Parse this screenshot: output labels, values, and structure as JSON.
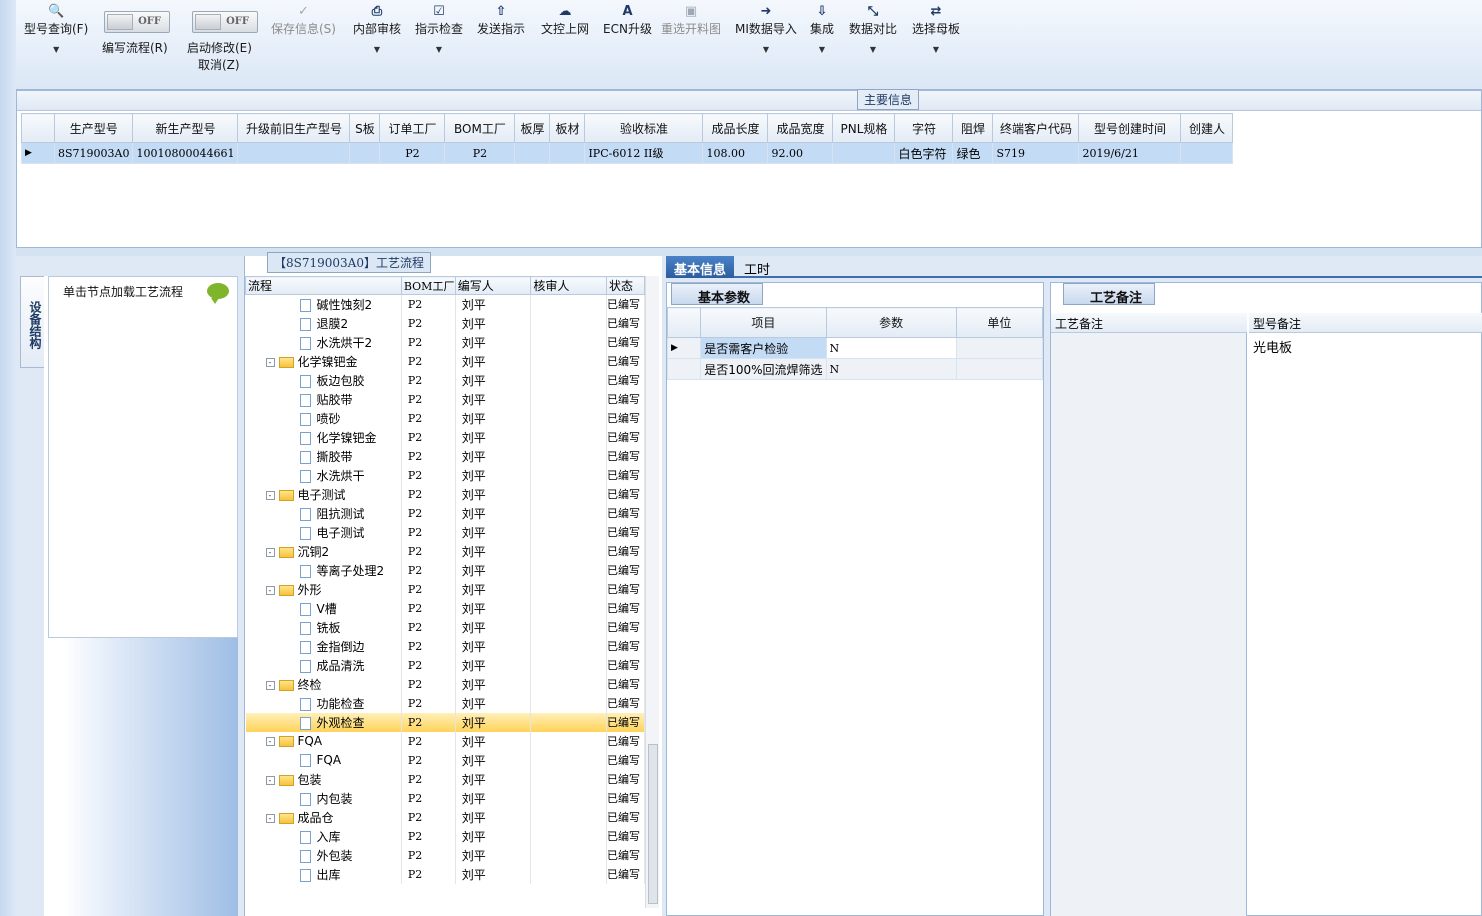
{
  "toolbar": {
    "query": "型号查询(F)",
    "edit_flow": "编写流程(R)",
    "edit_toggle": "OFF",
    "auto_modify": "启动修改(E)",
    "auto_toggle": "OFF",
    "cancel": "取消(Z)",
    "save": "保存信息(S)",
    "internal_review": "内部审核",
    "instruction_check": "指示检查",
    "send_instruction": "发送指示",
    "doc_online": "文控上网",
    "ecn_upgrade": "ECN升级",
    "reselect_cut": "重选开料图",
    "mi_import": "MI数据导入",
    "integrate": "集成",
    "compare": "数据对比",
    "select_master": "选择母板"
  },
  "main_info": {
    "section_label": "主要信息",
    "columns": [
      "生产型号",
      "新生产型号",
      "升级前旧生产型号",
      "S板",
      "订单工厂",
      "BOM工厂",
      "板厚",
      "板材",
      "验收标准",
      "成品长度",
      "成品宽度",
      "PNL规格",
      "字符",
      "阻焊",
      "终端客户代码",
      "型号创建时间",
      "创建人"
    ],
    "rows": [
      [
        "8S719003A0",
        "10010800044661",
        "",
        "",
        "P2",
        "P2",
        "",
        "",
        "IPC-6012 II级",
        "108.00",
        "92.00",
        "",
        "白色字符",
        "绿色",
        "S719",
        "2019/6/21",
        ""
      ]
    ]
  },
  "side": {
    "tab": "设备结构",
    "tree_title": "单击节点加载工艺流程"
  },
  "process": {
    "caption": "【8S719003A0】工艺流程",
    "columns": [
      "流程",
      "BOM工厂",
      "编写人",
      "核审人",
      "状态"
    ],
    "rows": [
      {
        "name": "碱性蚀刻2",
        "type": "doc",
        "factory": "P2",
        "writer": "刘平",
        "reviewer": "",
        "status": "已编写"
      },
      {
        "name": "退膜2",
        "type": "doc",
        "factory": "P2",
        "writer": "刘平",
        "reviewer": "",
        "status": "已编写"
      },
      {
        "name": "水洗烘干2",
        "type": "doc",
        "factory": "P2",
        "writer": "刘平",
        "reviewer": "",
        "status": "已编写"
      },
      {
        "name": "化学镍钯金",
        "type": "folder",
        "factory": "P2",
        "writer": "刘平",
        "reviewer": "",
        "status": "已编写"
      },
      {
        "name": "板边包胶",
        "type": "doc",
        "factory": "P2",
        "writer": "刘平",
        "reviewer": "",
        "status": "已编写"
      },
      {
        "name": "贴胶带",
        "type": "doc",
        "factory": "P2",
        "writer": "刘平",
        "reviewer": "",
        "status": "已编写"
      },
      {
        "name": "喷砂",
        "type": "doc",
        "factory": "P2",
        "writer": "刘平",
        "reviewer": "",
        "status": "已编写"
      },
      {
        "name": "化学镍钯金",
        "type": "doc",
        "factory": "P2",
        "writer": "刘平",
        "reviewer": "",
        "status": "已编写"
      },
      {
        "name": "撕胶带",
        "type": "doc",
        "factory": "P2",
        "writer": "刘平",
        "reviewer": "",
        "status": "已编写"
      },
      {
        "name": "水洗烘干",
        "type": "doc",
        "factory": "P2",
        "writer": "刘平",
        "reviewer": "",
        "status": "已编写"
      },
      {
        "name": "电子测试",
        "type": "folder",
        "factory": "P2",
        "writer": "刘平",
        "reviewer": "",
        "status": "已编写"
      },
      {
        "name": "阻抗测试",
        "type": "doc",
        "factory": "P2",
        "writer": "刘平",
        "reviewer": "",
        "status": "已编写"
      },
      {
        "name": "电子测试",
        "type": "doc",
        "factory": "P2",
        "writer": "刘平",
        "reviewer": "",
        "status": "已编写"
      },
      {
        "name": "沉铜2",
        "type": "folder",
        "factory": "P2",
        "writer": "刘平",
        "reviewer": "",
        "status": "已编写"
      },
      {
        "name": "等离子处理2",
        "type": "doc",
        "factory": "P2",
        "writer": "刘平",
        "reviewer": "",
        "status": "已编写"
      },
      {
        "name": "外形",
        "type": "folder",
        "factory": "P2",
        "writer": "刘平",
        "reviewer": "",
        "status": "已编写"
      },
      {
        "name": "V槽",
        "type": "doc",
        "factory": "P2",
        "writer": "刘平",
        "reviewer": "",
        "status": "已编写"
      },
      {
        "name": "铣板",
        "type": "doc",
        "factory": "P2",
        "writer": "刘平",
        "reviewer": "",
        "status": "已编写"
      },
      {
        "name": "金指倒边",
        "type": "doc",
        "factory": "P2",
        "writer": "刘平",
        "reviewer": "",
        "status": "已编写"
      },
      {
        "name": "成品清洗",
        "type": "doc",
        "factory": "P2",
        "writer": "刘平",
        "reviewer": "",
        "status": "已编写"
      },
      {
        "name": "终检",
        "type": "folder",
        "factory": "P2",
        "writer": "刘平",
        "reviewer": "",
        "status": "已编写"
      },
      {
        "name": "功能检查",
        "type": "doc",
        "factory": "P2",
        "writer": "刘平",
        "reviewer": "",
        "status": "已编写"
      },
      {
        "name": "外观检查",
        "type": "doc",
        "factory": "P2",
        "writer": "刘平",
        "reviewer": "",
        "status": "已编写",
        "selected": true
      },
      {
        "name": "FQA",
        "type": "folder",
        "factory": "P2",
        "writer": "刘平",
        "reviewer": "",
        "status": "已编写"
      },
      {
        "name": "FQA",
        "type": "doc",
        "factory": "P2",
        "writer": "刘平",
        "reviewer": "",
        "status": "已编写"
      },
      {
        "name": "包装",
        "type": "folder",
        "factory": "P2",
        "writer": "刘平",
        "reviewer": "",
        "status": "已编写"
      },
      {
        "name": "内包装",
        "type": "doc",
        "factory": "P2",
        "writer": "刘平",
        "reviewer": "",
        "status": "已编写"
      },
      {
        "name": "成品仓",
        "type": "folder",
        "factory": "P2",
        "writer": "刘平",
        "reviewer": "",
        "status": "已编写"
      },
      {
        "name": "入库",
        "type": "doc",
        "factory": "P2",
        "writer": "刘平",
        "reviewer": "",
        "status": "已编写"
      },
      {
        "name": "外包装",
        "type": "doc",
        "factory": "P2",
        "writer": "刘平",
        "reviewer": "",
        "status": "已编写"
      },
      {
        "name": "出库",
        "type": "doc",
        "factory": "P2",
        "writer": "刘平",
        "reviewer": "",
        "status": "已编写"
      }
    ]
  },
  "right": {
    "tabs": [
      "基本信息",
      "工时"
    ],
    "basic_params_tab": "基本参数",
    "param_columns": [
      "项目",
      "参数",
      "单位"
    ],
    "params": [
      [
        "是否需客户检验",
        "N",
        ""
      ],
      [
        "是否100%回流焊筛选",
        "N",
        ""
      ]
    ],
    "notes_tab": "工艺备注",
    "process_note_header": "工艺备注",
    "model_note_header": "型号备注",
    "model_note_value": "光电板"
  }
}
